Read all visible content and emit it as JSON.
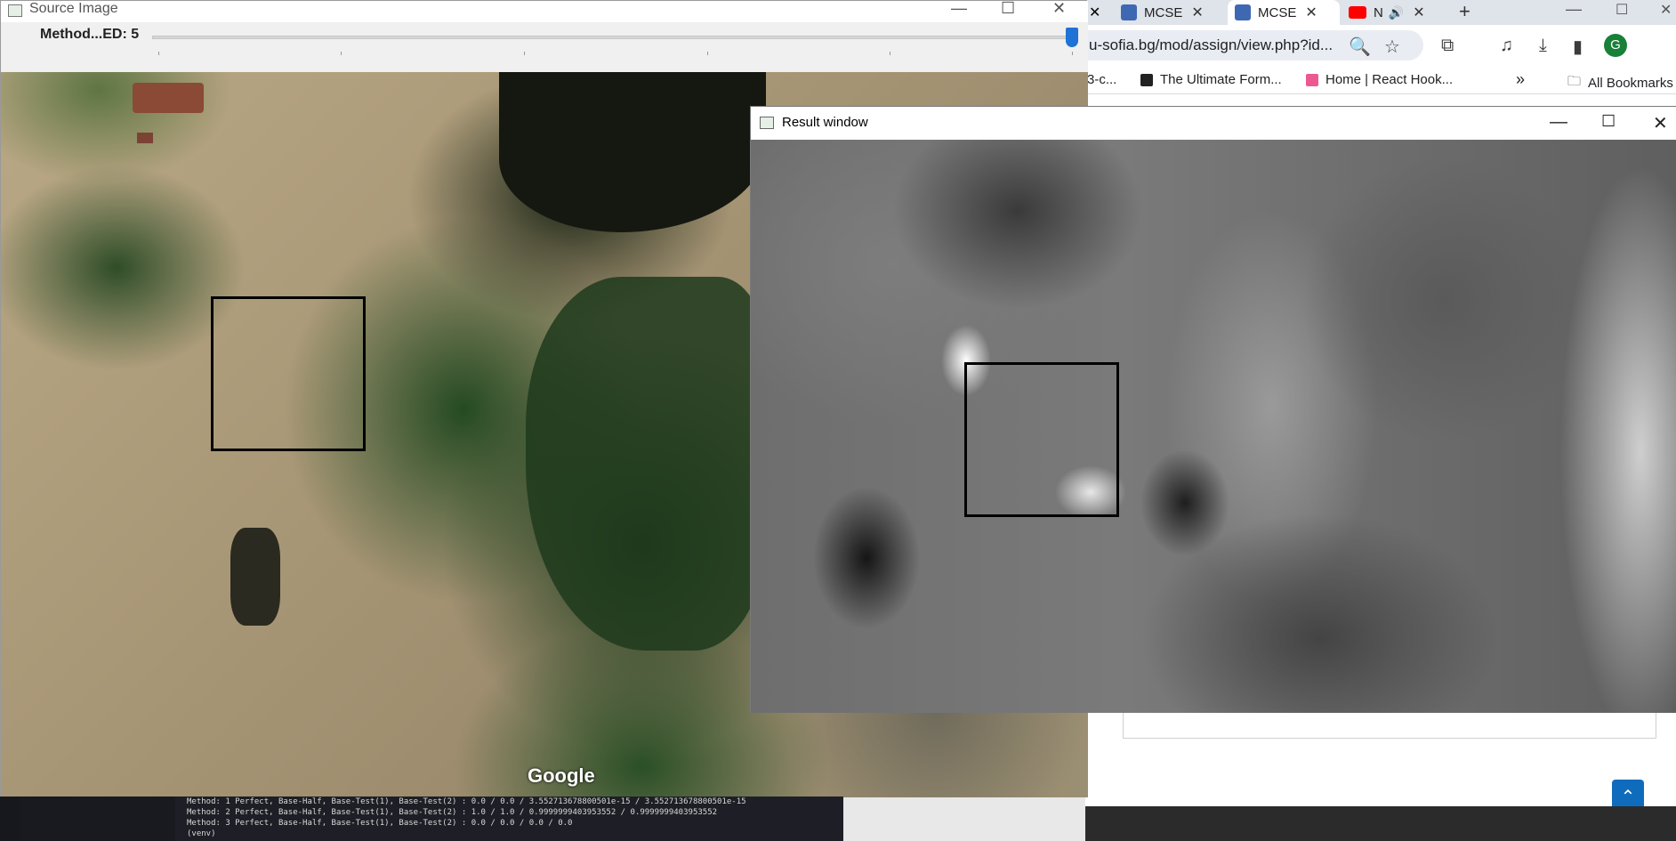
{
  "source_window": {
    "title": "Source Image",
    "trackbar_label": "Method...ED: 5",
    "trackbar_value": 5,
    "map_watermark": "Google"
  },
  "result_window": {
    "title": "Result window"
  },
  "browser": {
    "tabs": [
      {
        "label": "MCSE"
      },
      {
        "label": "MCSE"
      },
      {
        "label": "N"
      }
    ],
    "new_tab": "+",
    "url": "u-sofia.bg/mod/assign/view.php?id...",
    "bookmarks": [
      {
        "label": "3-c..."
      },
      {
        "label": "The Ultimate Form..."
      },
      {
        "label": "Home | React Hook..."
      },
      {
        "label": "All Bookmarks"
      }
    ],
    "profile_initial": "G",
    "scroll_top": "⌃"
  },
  "console": {
    "lines": [
      "Method: 1 Perfect, Base-Half, Base-Test(1), Base-Test(2) : 0.0 / 0.0 / 3.552713678800501e-15 / 3.552713678800501e-15",
      "Method: 2 Perfect, Base-Half, Base-Test(1), Base-Test(2) : 1.0 / 1.0 / 0.9999999403953552 / 0.9999999403953552",
      "Method: 3 Perfect, Base-Half, Base-Test(1), Base-Test(2) : 0.0 / 0.0 / 0.0 / 0.0",
      "(venv)"
    ]
  },
  "colors": {
    "accent": "#1f72d6",
    "chrome_tabstrip": "#dfe3ea",
    "youtube_red": "#ff0000",
    "profile_green": "#188038"
  }
}
